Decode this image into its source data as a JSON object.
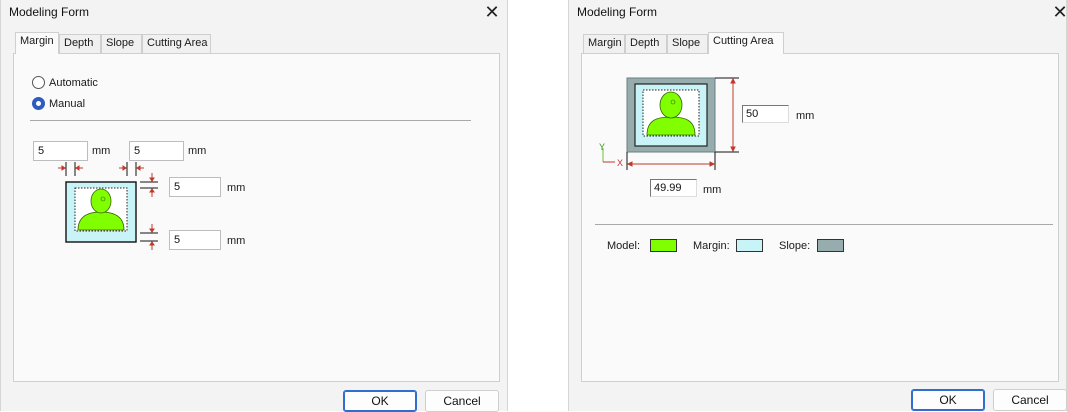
{
  "dialog1": {
    "title": "Modeling Form",
    "tabs": [
      {
        "label": "Margin",
        "active": true
      },
      {
        "label": "Depth",
        "active": false
      },
      {
        "label": "Slope",
        "active": false
      },
      {
        "label": "Cutting Area",
        "active": false
      }
    ],
    "radios": {
      "automatic": {
        "label": "Automatic",
        "selected": false
      },
      "manual": {
        "label": "Manual",
        "selected": true
      }
    },
    "margins": {
      "left": {
        "value": "5",
        "unit": "mm"
      },
      "right": {
        "value": "5",
        "unit": "mm"
      },
      "top": {
        "value": "5",
        "unit": "mm"
      },
      "bottom": {
        "value": "5",
        "unit": "mm"
      }
    },
    "buttons": {
      "ok": "OK",
      "cancel": "Cancel"
    }
  },
  "dialog2": {
    "title": "Modeling Form",
    "tabs": [
      {
        "label": "Margin",
        "active": false
      },
      {
        "label": "Depth",
        "active": false
      },
      {
        "label": "Slope",
        "active": false
      },
      {
        "label": "Cutting Area",
        "active": true
      }
    ],
    "height": {
      "value": "50",
      "unit": "mm"
    },
    "width": {
      "value": "49.99",
      "unit": "mm"
    },
    "axis": {
      "x": "X",
      "y": "Y"
    },
    "legend": [
      {
        "label": "Model:",
        "color": "#80ff00"
      },
      {
        "label": "Margin:",
        "color": "#c8f4f8"
      },
      {
        "label": "Slope:",
        "color": "#97acac"
      }
    ],
    "buttons": {
      "ok": "OK",
      "cancel": "Cancel"
    }
  },
  "colors": {
    "model": "#80ff00",
    "margin": "#c8f4f8",
    "slope": "#97acac",
    "dimension_arrow": "#c0392b",
    "accent": "#2f5cbf"
  }
}
